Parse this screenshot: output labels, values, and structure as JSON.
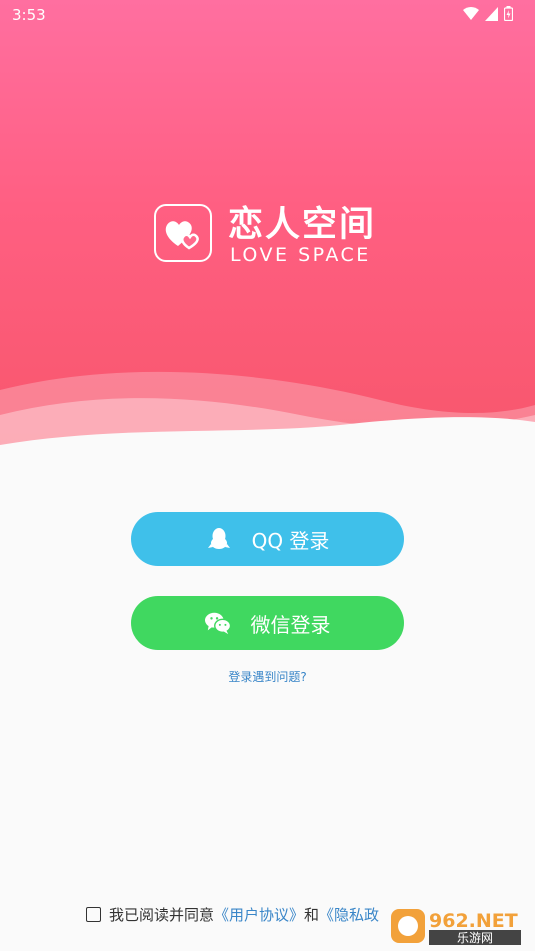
{
  "status_bar": {
    "time": "3:53"
  },
  "brand": {
    "title": "恋人空间",
    "subtitle": "LOVE SPACE"
  },
  "buttons": {
    "qq_login": "QQ 登录",
    "wechat_login": "微信登录"
  },
  "help_link": "登录遇到问题?",
  "agreement": {
    "prefix": "我已阅读并同意",
    "user_agreement": "《用户协议》",
    "and": "和",
    "privacy_policy": "《隐私政"
  },
  "watermark": {
    "top": "962.NET",
    "bottom": "乐游网"
  },
  "colors": {
    "hero_top": "#ff6fa0",
    "hero_bottom": "#f7566b",
    "qq_button": "#3fc0ea",
    "wechat_button": "#40d860",
    "link": "#3a86c8"
  }
}
